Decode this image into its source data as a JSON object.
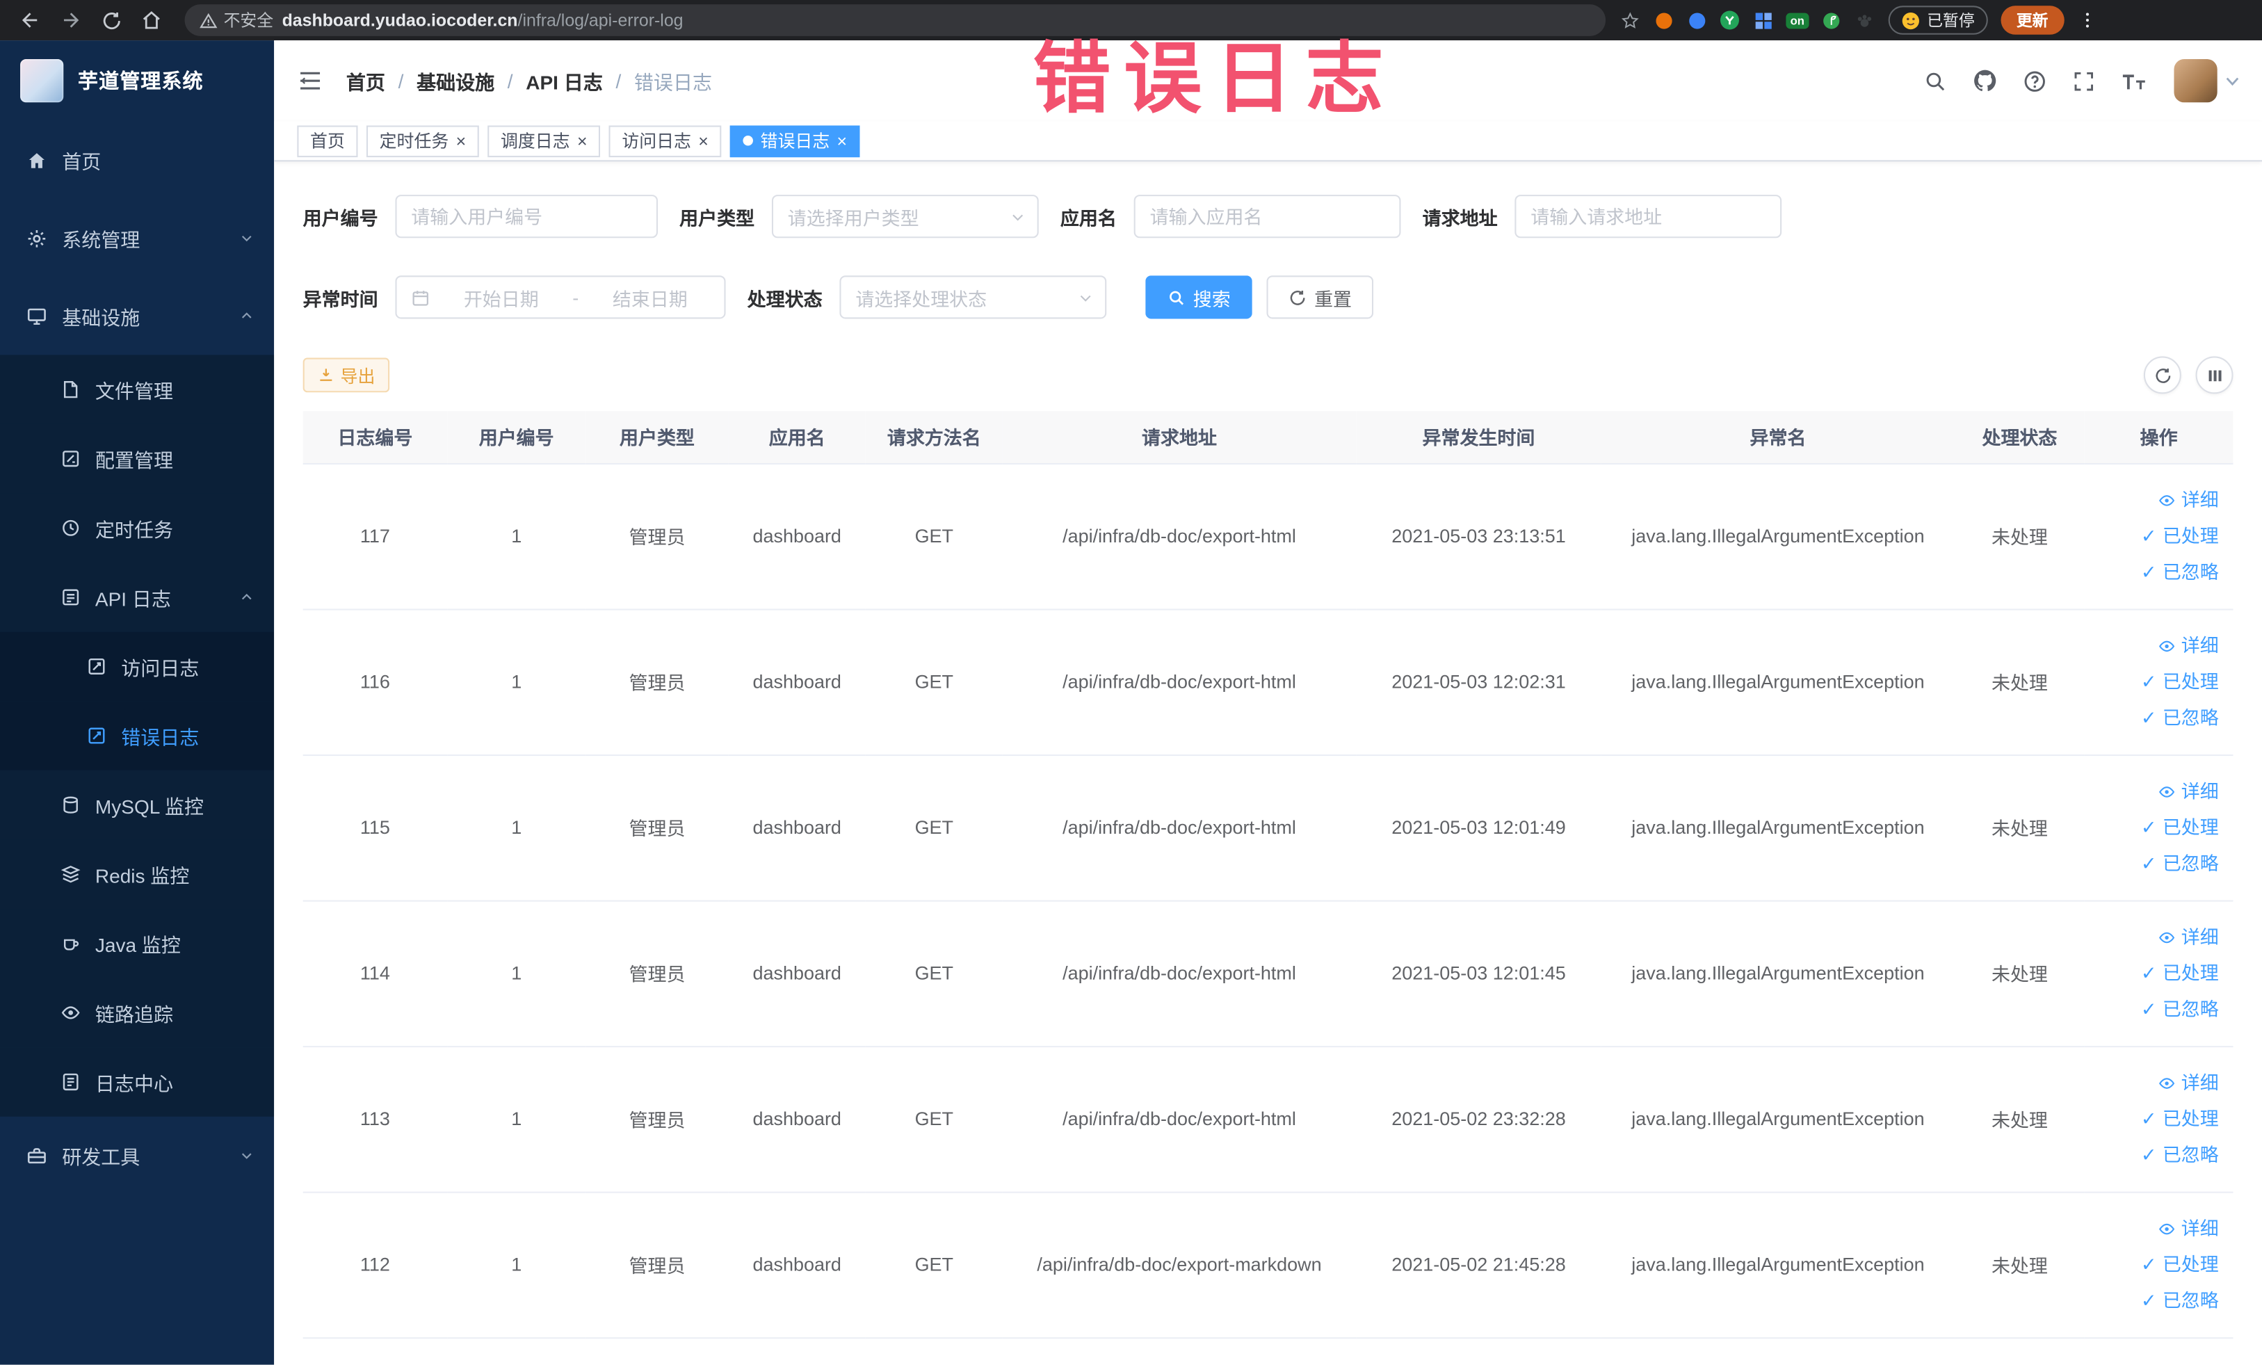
{
  "annotation": {
    "text": "错误日志"
  },
  "glyphs": {
    "close": "×",
    "check": "✓",
    "separator": "/",
    "dash": "-"
  },
  "browser": {
    "security_label": "不安全",
    "url_domain": "dashboard.yudao.iocoder.cn",
    "url_path": "/infra/log/api-error-log",
    "extension_badge": "on",
    "paused_badge": "已暂停",
    "update_button": "更新"
  },
  "sidebar": {
    "logo_title": "芋道管理系统",
    "items": [
      {
        "label": "首页"
      },
      {
        "label": "系统管理"
      },
      {
        "label": "基础设施"
      },
      {
        "label": "文件管理"
      },
      {
        "label": "配置管理"
      },
      {
        "label": "定时任务"
      },
      {
        "label": "API 日志"
      },
      {
        "label": "访问日志"
      },
      {
        "label": "错误日志"
      },
      {
        "label": "MySQL 监控"
      },
      {
        "label": "Redis 监控"
      },
      {
        "label": "Java 监控"
      },
      {
        "label": "链路追踪"
      },
      {
        "label": "日志中心"
      },
      {
        "label": "研发工具"
      }
    ]
  },
  "header": {
    "breadcrumbs": [
      "首页",
      "基础设施",
      "API 日志",
      "错误日志"
    ]
  },
  "tags": [
    {
      "label": "首页"
    },
    {
      "label": "定时任务"
    },
    {
      "label": "调度日志"
    },
    {
      "label": "访问日志"
    },
    {
      "label": "错误日志"
    }
  ],
  "filters": {
    "user_id_label": "用户编号",
    "user_id_placeholder": "请输入用户编号",
    "user_type_label": "用户类型",
    "user_type_placeholder": "请选择用户类型",
    "app_name_label": "应用名",
    "app_name_placeholder": "请输入应用名",
    "request_url_label": "请求地址",
    "request_url_placeholder": "请输入请求地址",
    "exception_time_label": "异常时间",
    "start_date_placeholder": "开始日期",
    "end_date_placeholder": "结束日期",
    "process_status_label": "处理状态",
    "process_status_placeholder": "请选择处理状态",
    "search_button": "搜索",
    "reset_button": "重置"
  },
  "toolbar": {
    "export_button": "导出"
  },
  "table": {
    "columns": [
      "日志编号",
      "用户编号",
      "用户类型",
      "应用名",
      "请求方法名",
      "请求地址",
      "异常发生时间",
      "异常名",
      "处理状态",
      "操作"
    ],
    "actions": [
      "详细",
      "已处理",
      "已忽略"
    ],
    "rows": [
      {
        "id": "117",
        "user": "1",
        "type": "管理员",
        "app": "dashboard",
        "method": "GET",
        "url": "/api/infra/db-doc/export-html",
        "time": "2021-05-03 23:13:51",
        "exception": "java.lang.IllegalArgumentException",
        "status": "未处理"
      },
      {
        "id": "116",
        "user": "1",
        "type": "管理员",
        "app": "dashboard",
        "method": "GET",
        "url": "/api/infra/db-doc/export-html",
        "time": "2021-05-03 12:02:31",
        "exception": "java.lang.IllegalArgumentException",
        "status": "未处理"
      },
      {
        "id": "115",
        "user": "1",
        "type": "管理员",
        "app": "dashboard",
        "method": "GET",
        "url": "/api/infra/db-doc/export-html",
        "time": "2021-05-03 12:01:49",
        "exception": "java.lang.IllegalArgumentException",
        "status": "未处理"
      },
      {
        "id": "114",
        "user": "1",
        "type": "管理员",
        "app": "dashboard",
        "method": "GET",
        "url": "/api/infra/db-doc/export-html",
        "time": "2021-05-03 12:01:45",
        "exception": "java.lang.IllegalArgumentException",
        "status": "未处理"
      },
      {
        "id": "113",
        "user": "1",
        "type": "管理员",
        "app": "dashboard",
        "method": "GET",
        "url": "/api/infra/db-doc/export-html",
        "time": "2021-05-02 23:32:28",
        "exception": "java.lang.IllegalArgumentException",
        "status": "未处理"
      },
      {
        "id": "112",
        "user": "1",
        "type": "管理员",
        "app": "dashboard",
        "method": "GET",
        "url": "/api/infra/db-doc/export-markdown",
        "time": "2021-05-02 21:45:28",
        "exception": "java.lang.IllegalArgumentException",
        "status": "未处理"
      }
    ]
  }
}
